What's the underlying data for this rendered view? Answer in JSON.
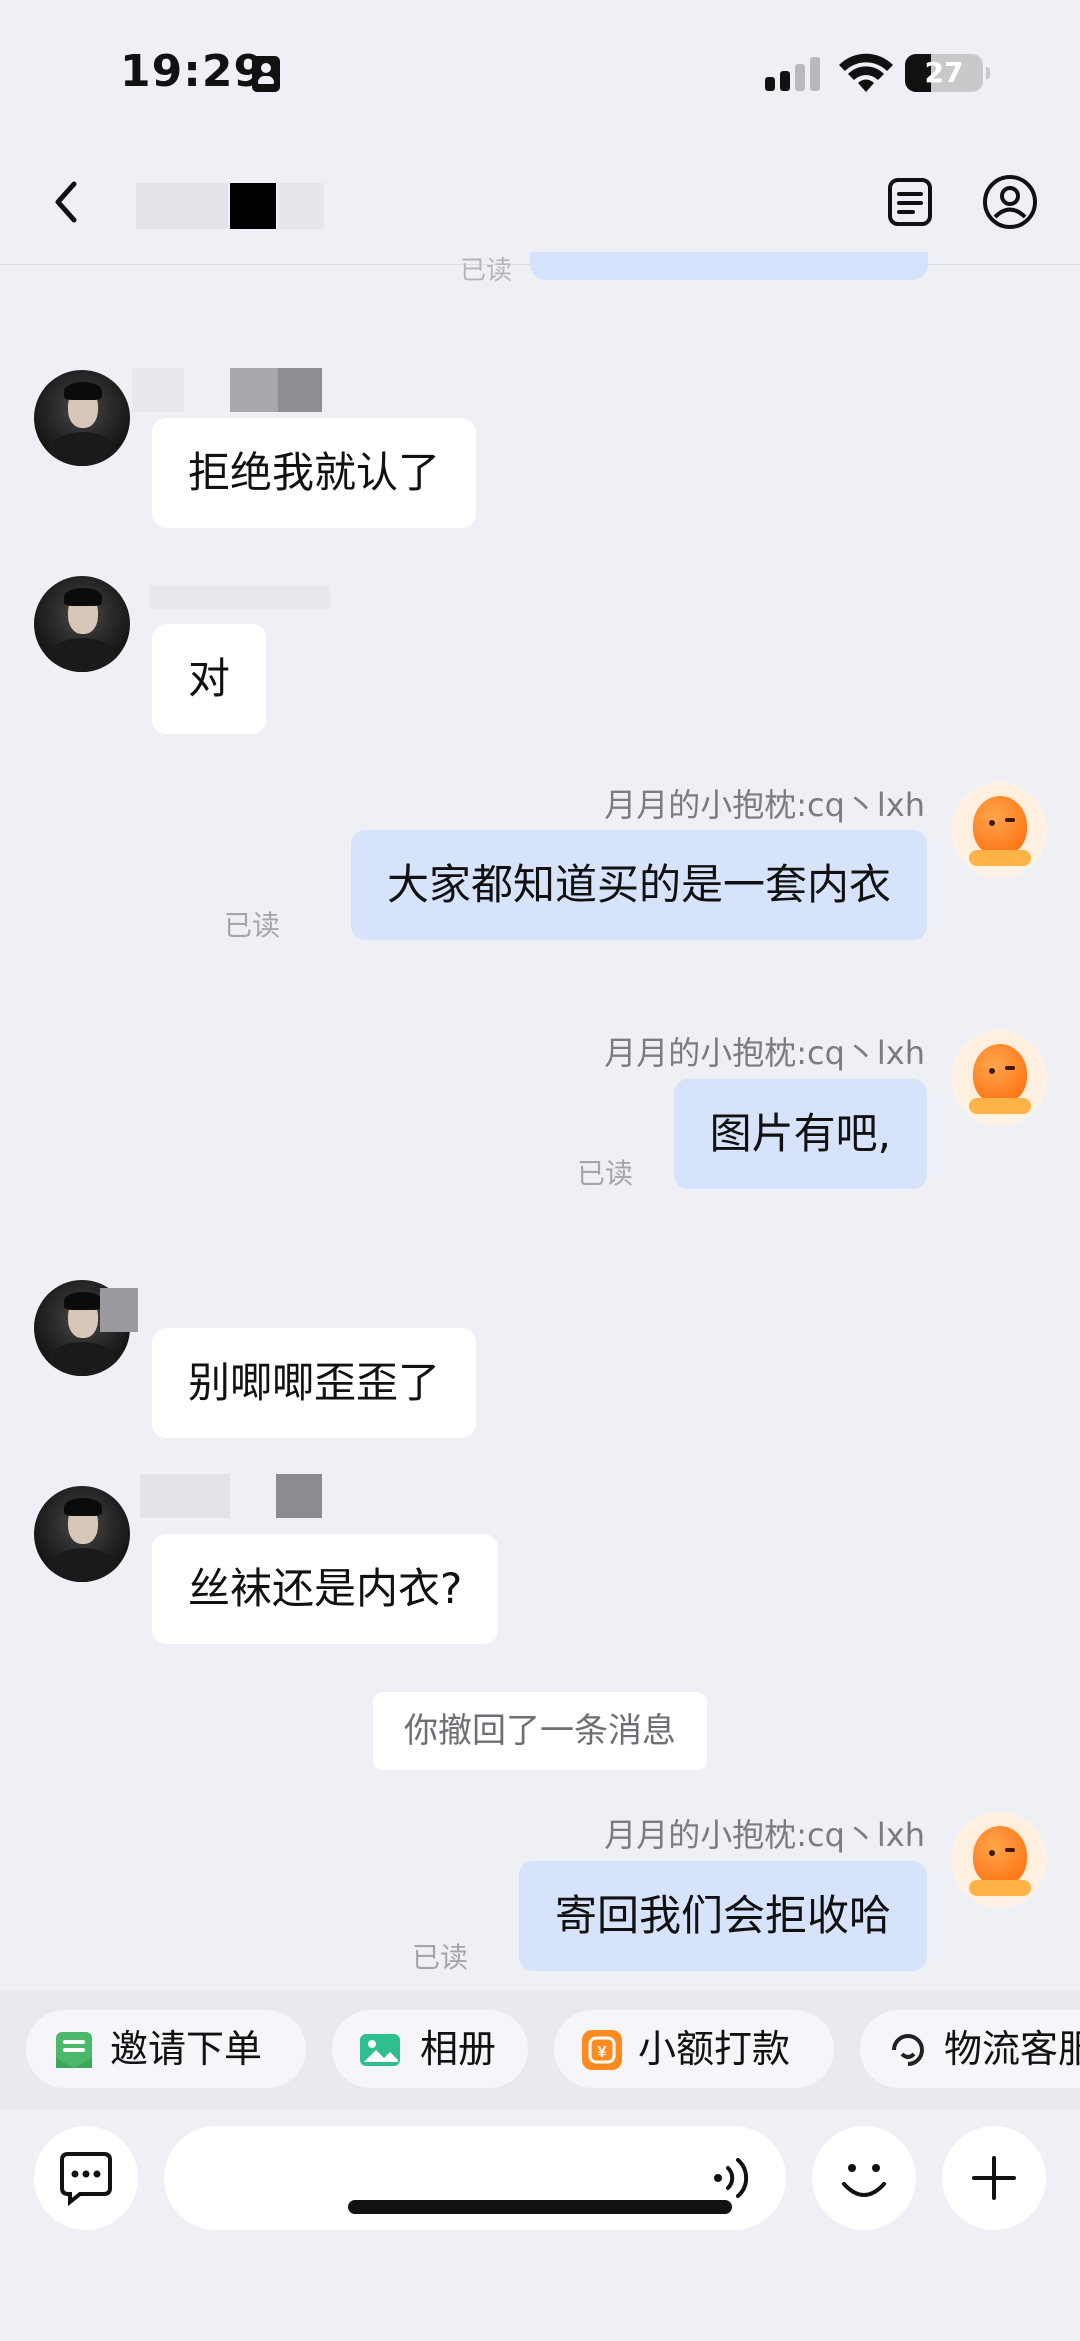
{
  "status_bar": {
    "time": "19:29",
    "battery": "27"
  },
  "header": {
    "back_icon": "chevron-left-icon",
    "title_blurred": "у",
    "icons": [
      "document-icon",
      "profile-icon"
    ]
  },
  "top_partial": {
    "read_label": "已读"
  },
  "messages": [
    {
      "side": "in",
      "text": "拒绝我就认了"
    },
    {
      "side": "in",
      "text": "对"
    },
    {
      "side": "out",
      "sender": "月月的小抱枕:cq丶lxh",
      "text": "大家都知道买的是一套内衣",
      "read": "已读"
    },
    {
      "side": "out",
      "sender": "月月的小抱枕:cq丶lxh",
      "text": "图片有吧,",
      "read": "已读"
    },
    {
      "side": "in",
      "text": "别唧唧歪歪了"
    },
    {
      "side": "in",
      "text": "丝袜还是内衣?"
    },
    {
      "side": "out",
      "sender": "月月的小抱枕:cq丶lxh",
      "text": "寄回我们会拒收哈",
      "read": "已读"
    }
  ],
  "system_message": "你撤回了一条消息",
  "quick_actions": [
    {
      "label": "邀请下单",
      "icon": "invite-order-icon",
      "color": "#4cb86a"
    },
    {
      "label": "相册",
      "icon": "album-icon",
      "color": "#2fbf8f"
    },
    {
      "label": "小额打款",
      "icon": "payment-icon",
      "color": "#ff8a1f"
    },
    {
      "label": "物流客服",
      "icon": "logistics-service-icon",
      "color": "#222222"
    }
  ],
  "input_bar": {
    "icons": [
      "chat-bubble-icon",
      "voice-icon",
      "emoji-icon",
      "plus-icon"
    ]
  }
}
